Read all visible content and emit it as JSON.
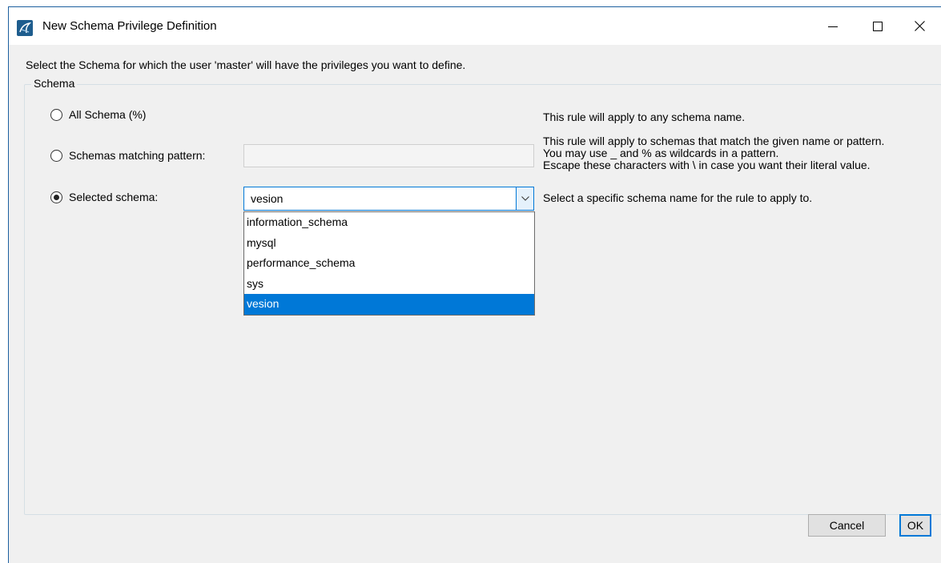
{
  "window": {
    "title": "New Schema Privilege Definition",
    "controls": {
      "minimize": "minimize-icon",
      "maximize": "maximize-icon",
      "close": "close-icon"
    }
  },
  "instruction": "Select the Schema for which the user 'master' will have the privileges you want to define.",
  "group": {
    "label": "Schema",
    "options": [
      {
        "label": "All Schema (%)",
        "selected": false,
        "description": "This rule will apply to any schema name."
      },
      {
        "label": "Schemas matching pattern:",
        "selected": false,
        "description_lines": [
          "This rule will apply to schemas that match the given name or pattern.",
          "You may use _ and % as wildcards in a pattern.",
          "Escape these characters with \\ in case you want their literal value."
        ],
        "input_value": ""
      },
      {
        "label": "Selected schema:",
        "selected": true,
        "description": "Select a specific schema name for the rule to apply to."
      }
    ]
  },
  "schema_combo": {
    "value": "vesion",
    "items": [
      "information_schema",
      "mysql",
      "performance_schema",
      "sys",
      "vesion"
    ],
    "highlighted": "vesion"
  },
  "buttons": {
    "cancel": "Cancel",
    "ok": "OK"
  },
  "colors": {
    "accent": "#0078d7",
    "dialog_bg": "#f0f0f0"
  }
}
